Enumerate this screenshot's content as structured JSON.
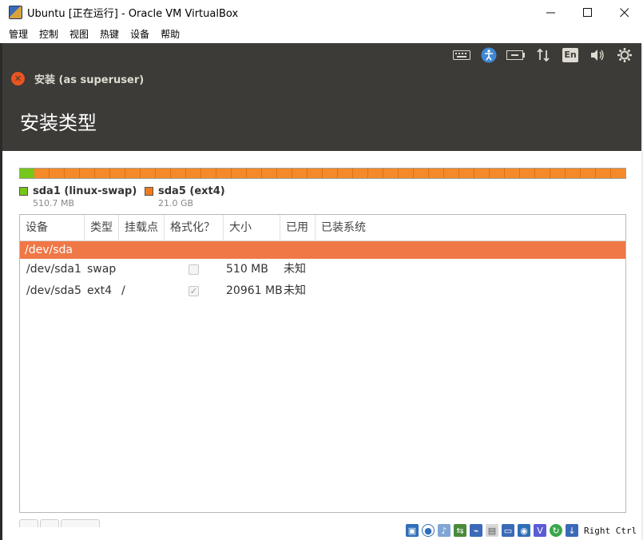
{
  "window": {
    "title": "Ubuntu [正在运行] - Oracle VM VirtualBox",
    "minimize_glyph": "—",
    "close_glyph": "✕"
  },
  "menubar": [
    "管理",
    "控制",
    "视图",
    "热键",
    "设备",
    "帮助"
  ],
  "guest_panel": {
    "keyboard_layout": "En",
    "icons": [
      "keyboard-icon",
      "accessibility-icon",
      "battery-icon",
      "network-icon",
      "language-icon",
      "volume-icon",
      "settings-gear-icon"
    ]
  },
  "installer": {
    "window_title": "安装 (as superuser)",
    "page_title": "安装类型"
  },
  "partitions_legend": [
    {
      "name": "sda1 (linux-swap)",
      "size": "510.7 MB",
      "color": "#75c71a"
    },
    {
      "name": "sda5 (ext4)",
      "size": "21.0 GB",
      "color": "#f07b1e"
    }
  ],
  "disk_usage": {
    "sda1_fraction": 0.024
  },
  "table": {
    "headers": [
      "设备",
      "类型",
      "挂载点",
      "格式化？",
      "大小",
      "已用",
      "已装系统"
    ],
    "disk_row": "/dev/sda",
    "rows": [
      {
        "device": "/dev/sda1",
        "type": "swap",
        "mount": "",
        "format_checked": false,
        "format_mark": "",
        "size": "510 MB",
        "used": "未知"
      },
      {
        "device": "/dev/sda5",
        "type": "ext4",
        "mount": "/",
        "format_checked": true,
        "format_mark": "✓",
        "size": "20961 MB",
        "used": "未知"
      }
    ]
  },
  "statusbar": {
    "host_key": "Right Ctrl"
  },
  "colors": {
    "ubuntu_orange": "#e95420",
    "panel_dark": "#3c3b37",
    "selection": "#f07746"
  }
}
